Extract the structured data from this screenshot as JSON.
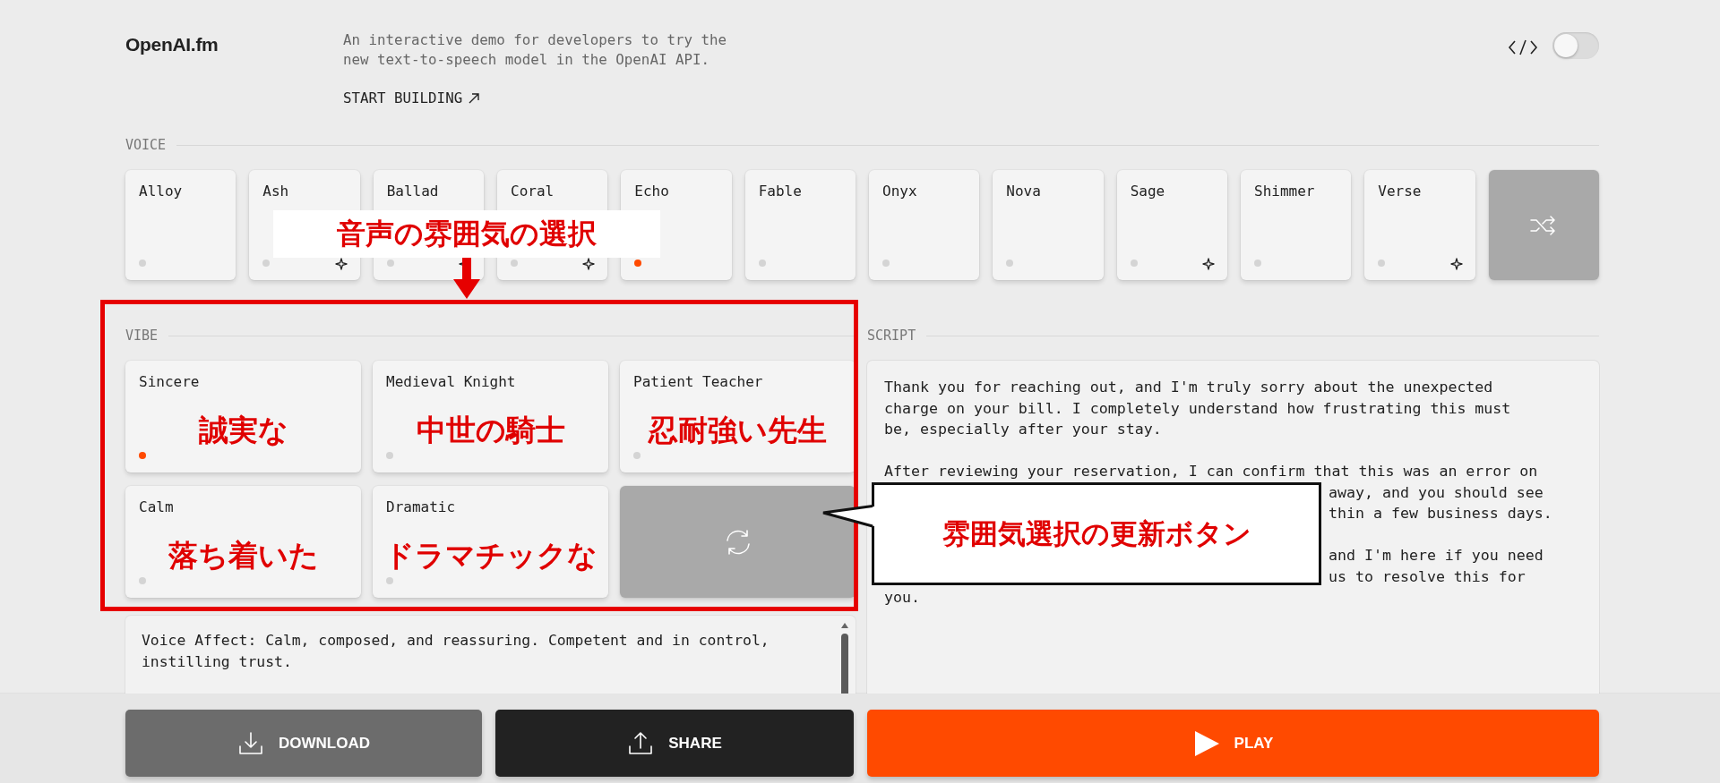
{
  "header": {
    "logo": "OpenAI.fm",
    "description": "An interactive demo for developers to try the new text-to-speech model in the OpenAI API.",
    "link": "START BUILDING",
    "code_toggle": {
      "on": false
    }
  },
  "voice": {
    "label": "VOICE",
    "voices": [
      {
        "name": "Alloy",
        "selected": false,
        "sparkle": false
      },
      {
        "name": "Ash",
        "selected": false,
        "sparkle": true
      },
      {
        "name": "Ballad",
        "selected": false,
        "sparkle": true
      },
      {
        "name": "Coral",
        "selected": false,
        "sparkle": true
      },
      {
        "name": "Echo",
        "selected": true,
        "sparkle": false
      },
      {
        "name": "Fable",
        "selected": false,
        "sparkle": false
      },
      {
        "name": "Onyx",
        "selected": false,
        "sparkle": false
      },
      {
        "name": "Nova",
        "selected": false,
        "sparkle": false
      },
      {
        "name": "Sage",
        "selected": false,
        "sparkle": true
      },
      {
        "name": "Shimmer",
        "selected": false,
        "sparkle": false
      },
      {
        "name": "Verse",
        "selected": false,
        "sparkle": true
      }
    ]
  },
  "vibe": {
    "label": "VIBE",
    "vibes": [
      {
        "name": "Sincere",
        "selected": true,
        "annotation": "誠実な"
      },
      {
        "name": "Medieval Knight",
        "selected": false,
        "annotation": "中世の騎士"
      },
      {
        "name": "Patient Teacher",
        "selected": false,
        "annotation": "忍耐強い先生"
      },
      {
        "name": "Calm",
        "selected": false,
        "annotation": "落ち着いた"
      },
      {
        "name": "Dramatic",
        "selected": false,
        "annotation": "ドラマチックな"
      }
    ]
  },
  "instructions": {
    "text": "Voice Affect: Calm, composed, and reassuring. Competent and in control, instilling trust."
  },
  "script": {
    "label": "SCRIPT",
    "lines": [
      {
        "text": "Thank you for reaching out, and I'm truly sorry about the unexpected",
        "kind": "line"
      },
      {
        "text": "charge on your bill. I completely understand how frustrating this must",
        "kind": "line"
      },
      {
        "text": "be, especially after your stay.",
        "kind": "line"
      },
      {
        "text": "After reviewing your reservation, I can confirm that this was an error on",
        "kind": "line",
        "gap": true
      },
      {
        "text": "away, and you should see",
        "kind": "behind_callout"
      },
      {
        "text": "thin a few business days.",
        "kind": "behind_callout"
      },
      {
        "text": "and I'm here if you need",
        "kind": "behind_callout",
        "gap": true
      },
      {
        "text": "us to resolve this for",
        "kind": "behind_callout"
      },
      {
        "text": "you.",
        "kind": "line"
      }
    ]
  },
  "actions": [
    {
      "label": "DOWNLOAD",
      "kind": "download"
    },
    {
      "label": "SHARE",
      "kind": "share"
    },
    {
      "label": "PLAY",
      "kind": "play"
    }
  ],
  "annotations": {
    "heading": "音声の雰囲気の選択",
    "callout": "雰囲気選択の更新ボタン"
  }
}
